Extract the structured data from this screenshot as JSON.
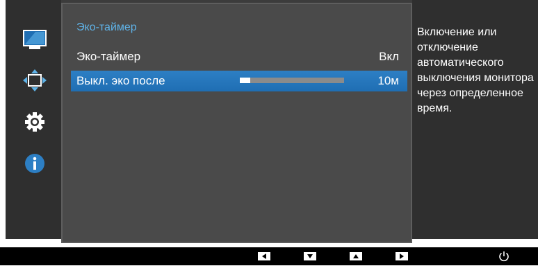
{
  "menu": {
    "title": "Эко-таймер",
    "rows": [
      {
        "label": "Эко-таймер",
        "value": "Вкл"
      },
      {
        "label": "Выкл. эко после",
        "value": "10м",
        "slider_fraction": 0.1
      }
    ]
  },
  "help": {
    "text": "Включение или отключение автоматического выключения монитора через определенное время."
  },
  "sidebar": {
    "icons": [
      "monitor-icon",
      "resize-arrows-icon",
      "gear-icon",
      "info-icon"
    ]
  },
  "keys": [
    "left-arrow-key",
    "down-arrow-key",
    "up-arrow-key",
    "right-arrow-key",
    "power-icon"
  ],
  "colors": {
    "accent": "#5fb3e8",
    "selected": "#1f6eb3",
    "panel": "#4a4a4a",
    "sidebar": "#2f2f2f"
  }
}
